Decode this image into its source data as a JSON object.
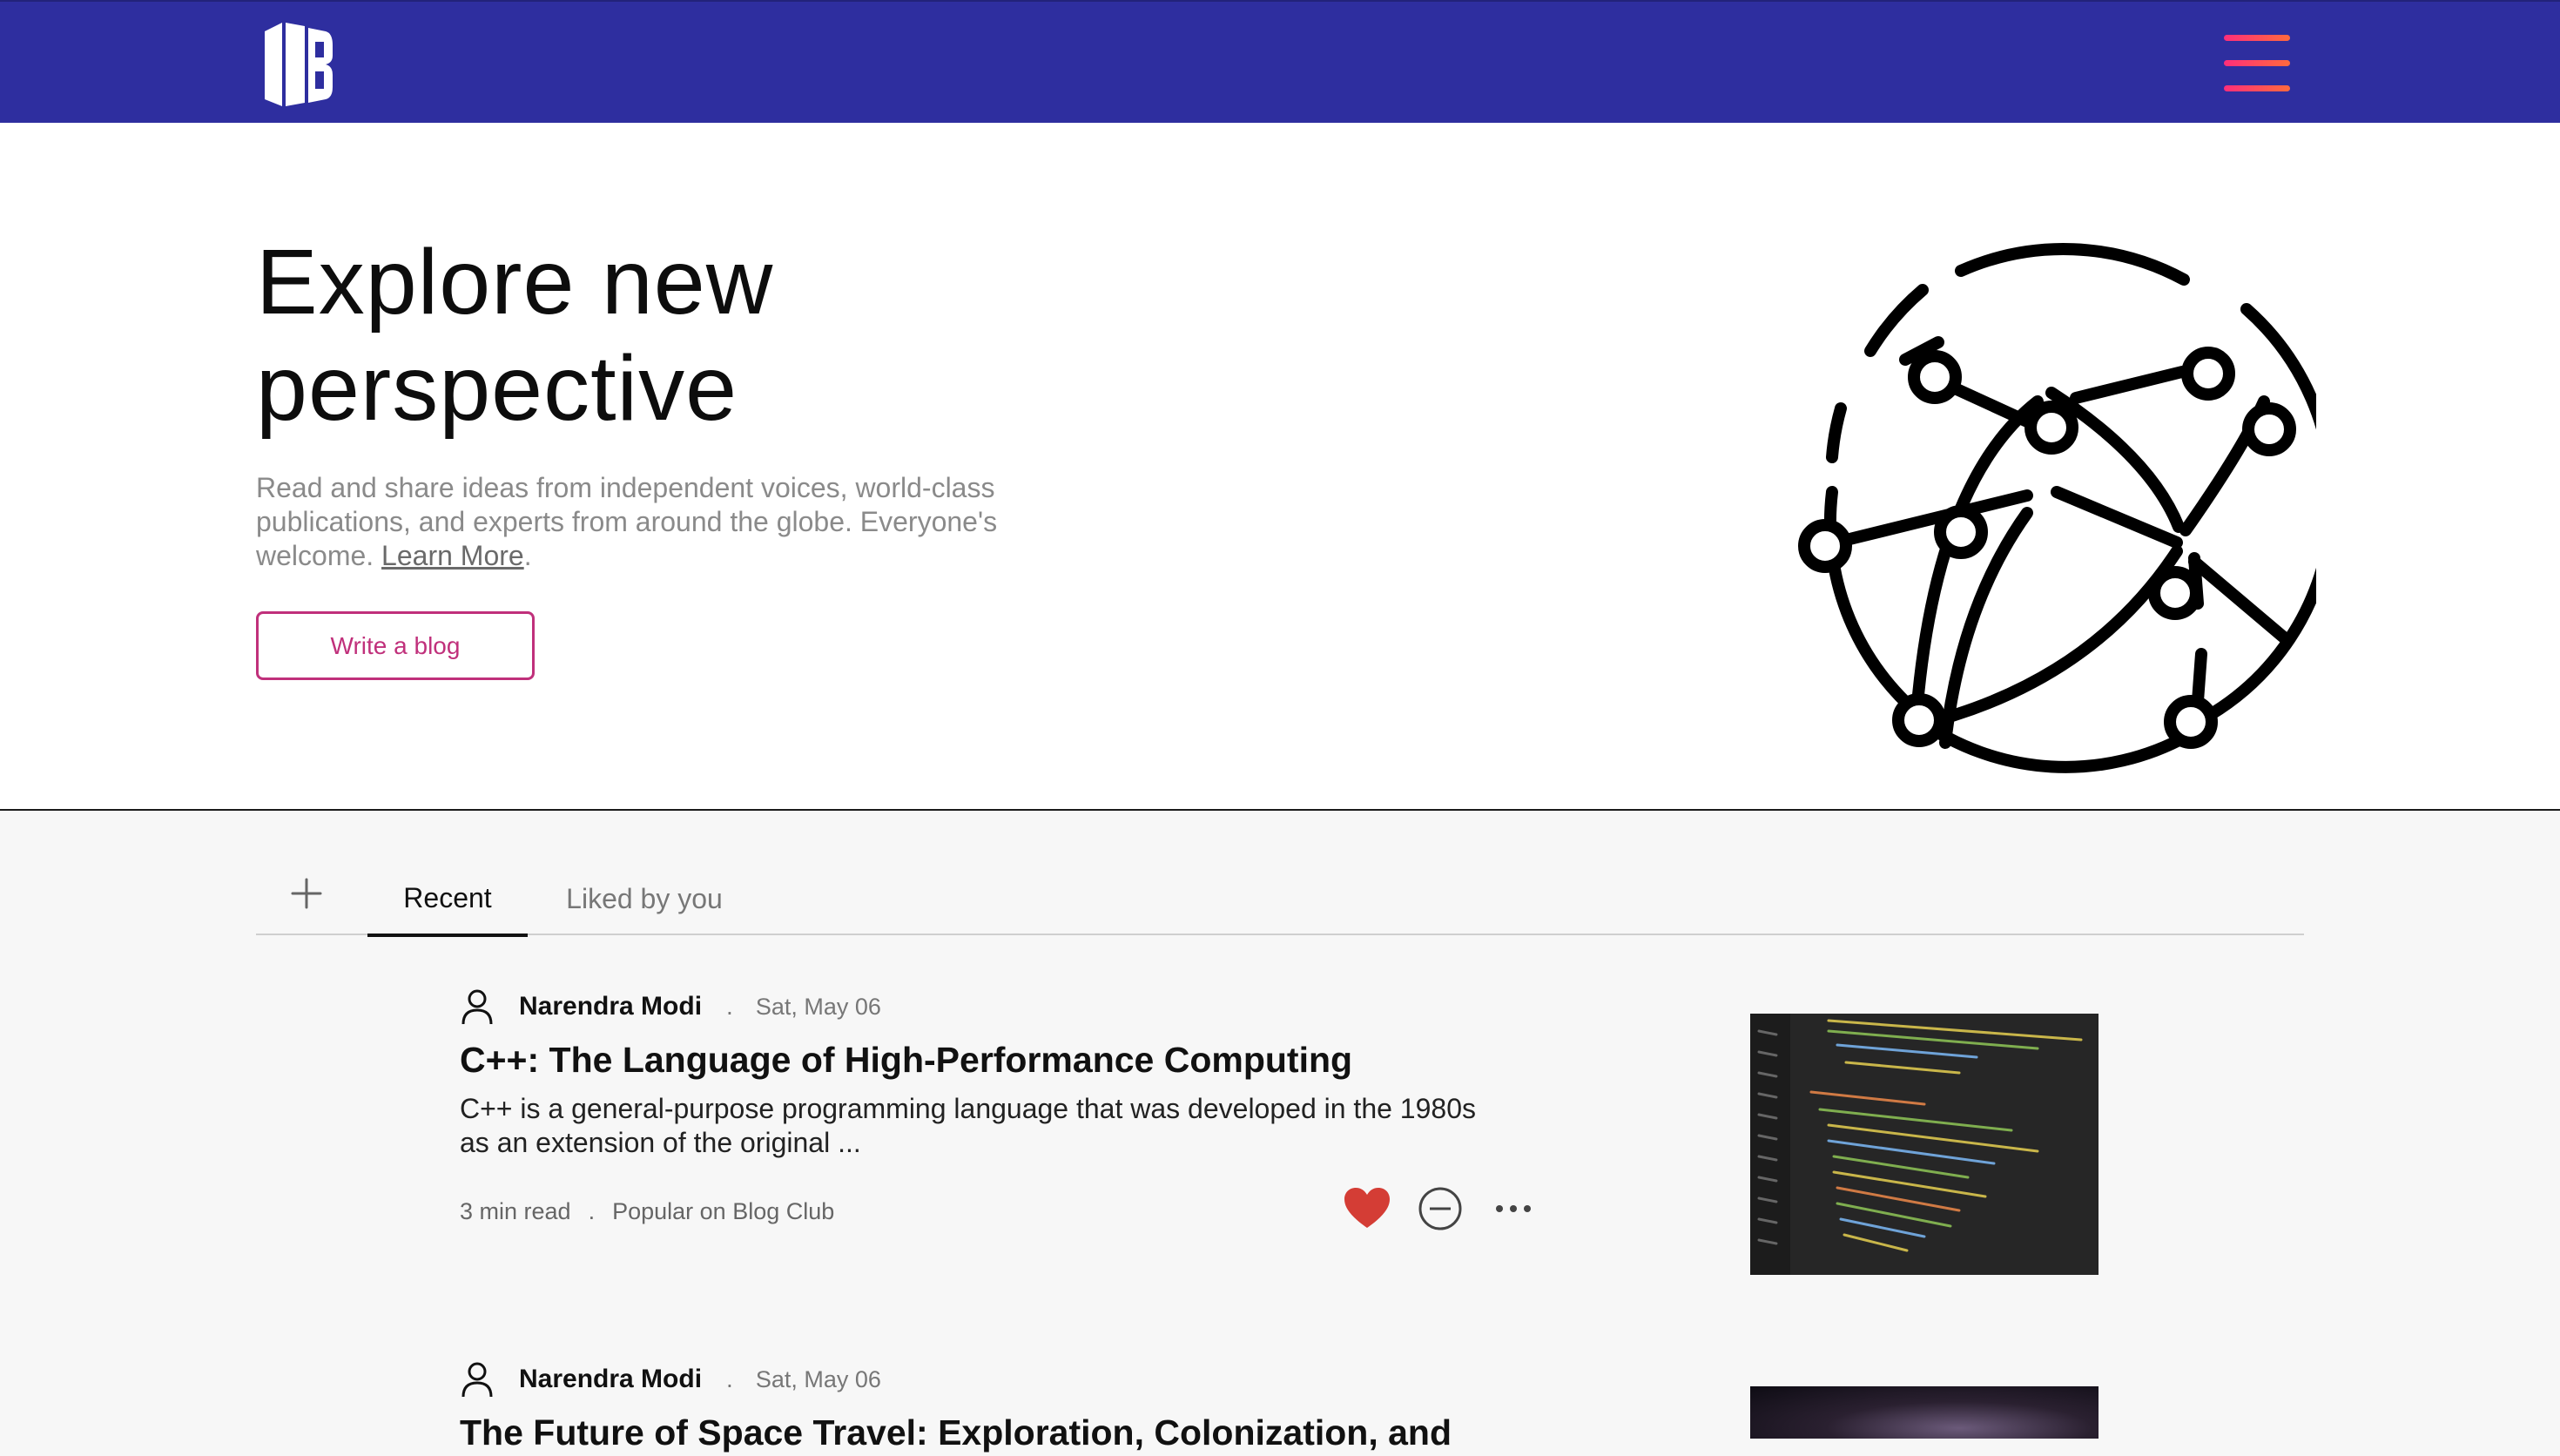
{
  "header": {
    "logo_alt": "IB",
    "menu_icon": "hamburger-icon",
    "colors": {
      "bar": "#2e2e9f",
      "menu_gradient": [
        "#ff2e7a",
        "#ff6a3d"
      ]
    }
  },
  "hero": {
    "title_line1": "Explore new",
    "title_line2": "perspective",
    "description": "Read and share ideas from independent voices, world-class publications, and experts from around the globe. Everyone's welcome.",
    "learn_more": "Learn More",
    "after_link": ".",
    "write_button": "Write a blog",
    "illustration_icon": "globe-network-icon",
    "accent": "#c0307b"
  },
  "tabs": {
    "add_icon": "plus-icon",
    "items": [
      {
        "label": "Recent",
        "active": true
      },
      {
        "label": "Liked by you",
        "active": false
      }
    ]
  },
  "posts": [
    {
      "author": "Narendra Modi",
      "date": "Sat, May 06",
      "title": "C++: The Language of High-Performance Computing",
      "excerpt": "C++ is a general-purpose programming language that was developed in the 1980s as an extension of the original ...",
      "read_time": "3 min read",
      "popularity": "Popular on Blog Club",
      "liked": true,
      "thumbnail": "code-editor-image"
    },
    {
      "author": "Narendra Modi",
      "date": "Sat, May 06",
      "title": "The Future of Space Travel: Exploration, Colonization, and",
      "thumbnail": "space-nebula-image"
    }
  ]
}
